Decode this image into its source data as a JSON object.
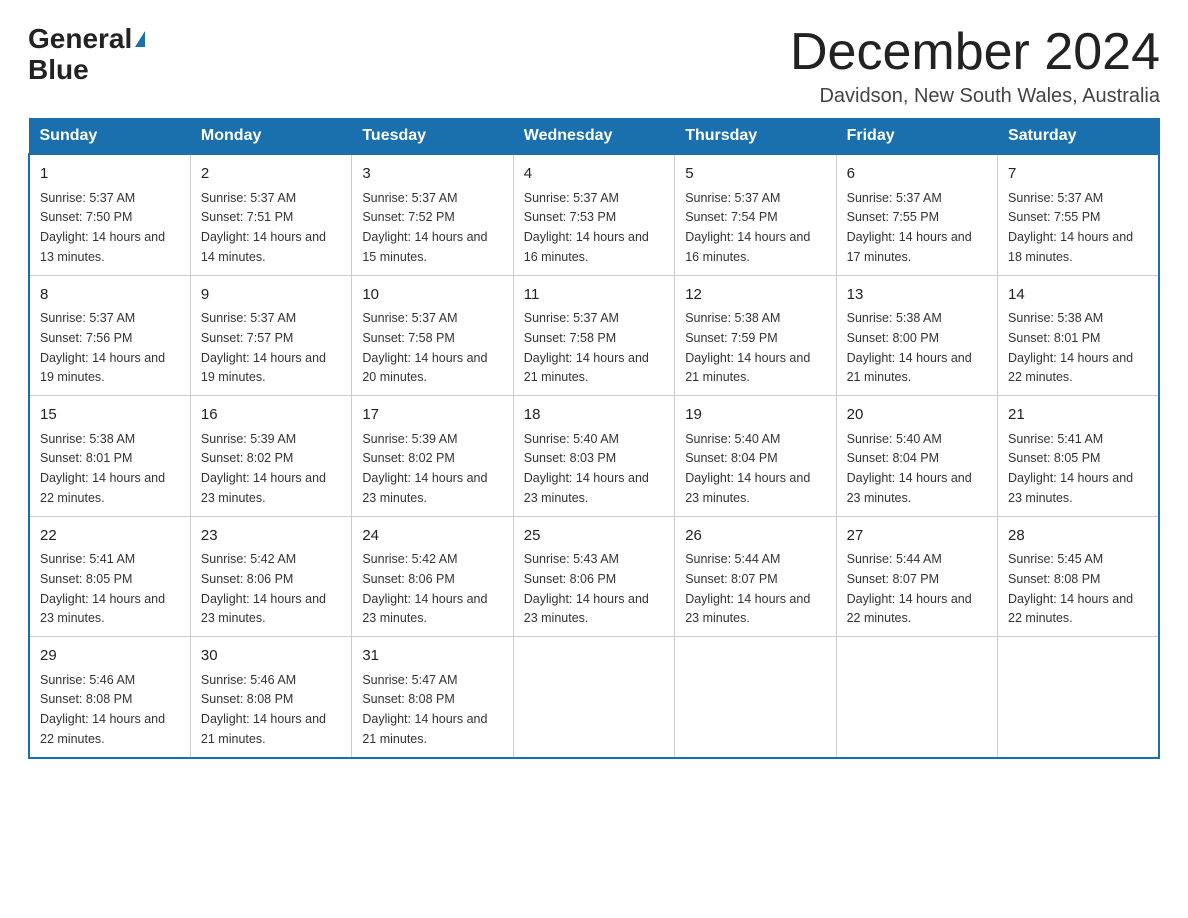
{
  "header": {
    "logo_general": "General",
    "logo_blue": "Blue",
    "title": "December 2024",
    "subtitle": "Davidson, New South Wales, Australia"
  },
  "weekdays": [
    "Sunday",
    "Monday",
    "Tuesday",
    "Wednesday",
    "Thursday",
    "Friday",
    "Saturday"
  ],
  "weeks": [
    [
      {
        "day": "1",
        "sunrise": "5:37 AM",
        "sunset": "7:50 PM",
        "daylight": "14 hours and 13 minutes."
      },
      {
        "day": "2",
        "sunrise": "5:37 AM",
        "sunset": "7:51 PM",
        "daylight": "14 hours and 14 minutes."
      },
      {
        "day": "3",
        "sunrise": "5:37 AM",
        "sunset": "7:52 PM",
        "daylight": "14 hours and 15 minutes."
      },
      {
        "day": "4",
        "sunrise": "5:37 AM",
        "sunset": "7:53 PM",
        "daylight": "14 hours and 16 minutes."
      },
      {
        "day": "5",
        "sunrise": "5:37 AM",
        "sunset": "7:54 PM",
        "daylight": "14 hours and 16 minutes."
      },
      {
        "day": "6",
        "sunrise": "5:37 AM",
        "sunset": "7:55 PM",
        "daylight": "14 hours and 17 minutes."
      },
      {
        "day": "7",
        "sunrise": "5:37 AM",
        "sunset": "7:55 PM",
        "daylight": "14 hours and 18 minutes."
      }
    ],
    [
      {
        "day": "8",
        "sunrise": "5:37 AM",
        "sunset": "7:56 PM",
        "daylight": "14 hours and 19 minutes."
      },
      {
        "day": "9",
        "sunrise": "5:37 AM",
        "sunset": "7:57 PM",
        "daylight": "14 hours and 19 minutes."
      },
      {
        "day": "10",
        "sunrise": "5:37 AM",
        "sunset": "7:58 PM",
        "daylight": "14 hours and 20 minutes."
      },
      {
        "day": "11",
        "sunrise": "5:37 AM",
        "sunset": "7:58 PM",
        "daylight": "14 hours and 21 minutes."
      },
      {
        "day": "12",
        "sunrise": "5:38 AM",
        "sunset": "7:59 PM",
        "daylight": "14 hours and 21 minutes."
      },
      {
        "day": "13",
        "sunrise": "5:38 AM",
        "sunset": "8:00 PM",
        "daylight": "14 hours and 21 minutes."
      },
      {
        "day": "14",
        "sunrise": "5:38 AM",
        "sunset": "8:01 PM",
        "daylight": "14 hours and 22 minutes."
      }
    ],
    [
      {
        "day": "15",
        "sunrise": "5:38 AM",
        "sunset": "8:01 PM",
        "daylight": "14 hours and 22 minutes."
      },
      {
        "day": "16",
        "sunrise": "5:39 AM",
        "sunset": "8:02 PM",
        "daylight": "14 hours and 23 minutes."
      },
      {
        "day": "17",
        "sunrise": "5:39 AM",
        "sunset": "8:02 PM",
        "daylight": "14 hours and 23 minutes."
      },
      {
        "day": "18",
        "sunrise": "5:40 AM",
        "sunset": "8:03 PM",
        "daylight": "14 hours and 23 minutes."
      },
      {
        "day": "19",
        "sunrise": "5:40 AM",
        "sunset": "8:04 PM",
        "daylight": "14 hours and 23 minutes."
      },
      {
        "day": "20",
        "sunrise": "5:40 AM",
        "sunset": "8:04 PM",
        "daylight": "14 hours and 23 minutes."
      },
      {
        "day": "21",
        "sunrise": "5:41 AM",
        "sunset": "8:05 PM",
        "daylight": "14 hours and 23 minutes."
      }
    ],
    [
      {
        "day": "22",
        "sunrise": "5:41 AM",
        "sunset": "8:05 PM",
        "daylight": "14 hours and 23 minutes."
      },
      {
        "day": "23",
        "sunrise": "5:42 AM",
        "sunset": "8:06 PM",
        "daylight": "14 hours and 23 minutes."
      },
      {
        "day": "24",
        "sunrise": "5:42 AM",
        "sunset": "8:06 PM",
        "daylight": "14 hours and 23 minutes."
      },
      {
        "day": "25",
        "sunrise": "5:43 AM",
        "sunset": "8:06 PM",
        "daylight": "14 hours and 23 minutes."
      },
      {
        "day": "26",
        "sunrise": "5:44 AM",
        "sunset": "8:07 PM",
        "daylight": "14 hours and 23 minutes."
      },
      {
        "day": "27",
        "sunrise": "5:44 AM",
        "sunset": "8:07 PM",
        "daylight": "14 hours and 22 minutes."
      },
      {
        "day": "28",
        "sunrise": "5:45 AM",
        "sunset": "8:08 PM",
        "daylight": "14 hours and 22 minutes."
      }
    ],
    [
      {
        "day": "29",
        "sunrise": "5:46 AM",
        "sunset": "8:08 PM",
        "daylight": "14 hours and 22 minutes."
      },
      {
        "day": "30",
        "sunrise": "5:46 AM",
        "sunset": "8:08 PM",
        "daylight": "14 hours and 21 minutes."
      },
      {
        "day": "31",
        "sunrise": "5:47 AM",
        "sunset": "8:08 PM",
        "daylight": "14 hours and 21 minutes."
      },
      null,
      null,
      null,
      null
    ]
  ]
}
